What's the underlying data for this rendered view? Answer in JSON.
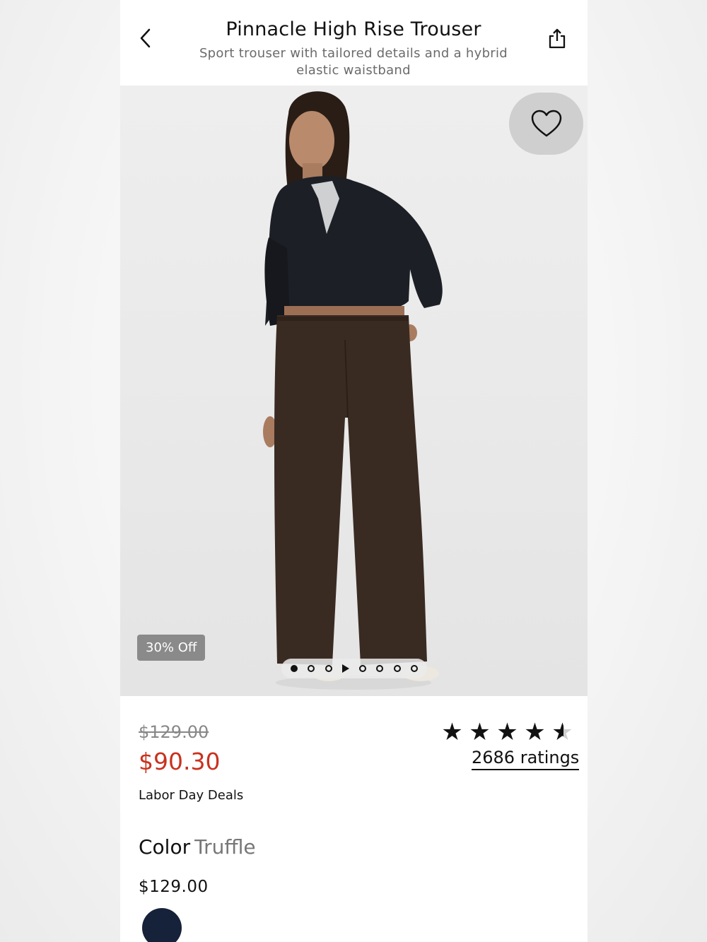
{
  "header": {
    "title": "Pinnacle High Rise Trouser",
    "subtitle": "Sport trouser with tailored details and a hybrid elastic waistband",
    "back_icon": "chevron-left-icon",
    "share_icon": "share-icon"
  },
  "hero": {
    "favorite_icon": "heart-icon",
    "badge": "30% Off",
    "carousel": {
      "total": 8,
      "active_index": 0,
      "has_video": true
    }
  },
  "pricing": {
    "original_price": "$129.00",
    "sale_price": "$90.30",
    "promo": "Labor Day Deals",
    "sale_color": "#c8321e"
  },
  "rating": {
    "stars": 4.6,
    "max_stars": 5,
    "count_label": "2686 ratings"
  },
  "color": {
    "label": "Color",
    "selected": "Truffle",
    "swatch_price": "$129.00",
    "swatches": [
      {
        "color": "#16213a"
      }
    ]
  }
}
